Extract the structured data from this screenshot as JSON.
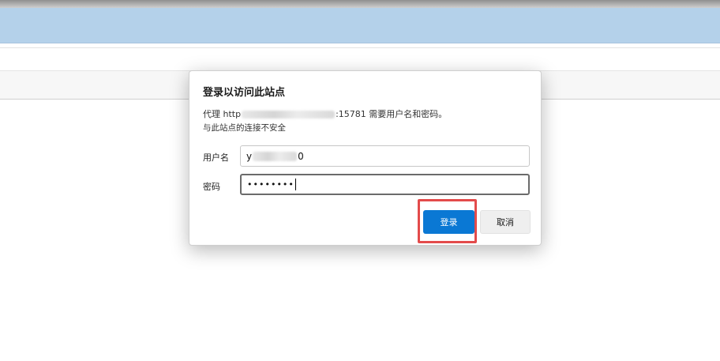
{
  "dialog": {
    "title": "登录以访问此站点",
    "message_prefix": "代理 http",
    "message_suffix": ":15781 需要用户名和密码。",
    "warning": "与此站点的连接不安全",
    "username_label": "用户名",
    "password_label": "密码",
    "username_start": "y",
    "username_end": "0",
    "password_value": "••••••••",
    "login_label": "登录",
    "cancel_label": "取消"
  },
  "colors": {
    "title_bar": "#b4d1ea",
    "primary_button": "#0a78d4",
    "highlight": "#e34b4b"
  }
}
